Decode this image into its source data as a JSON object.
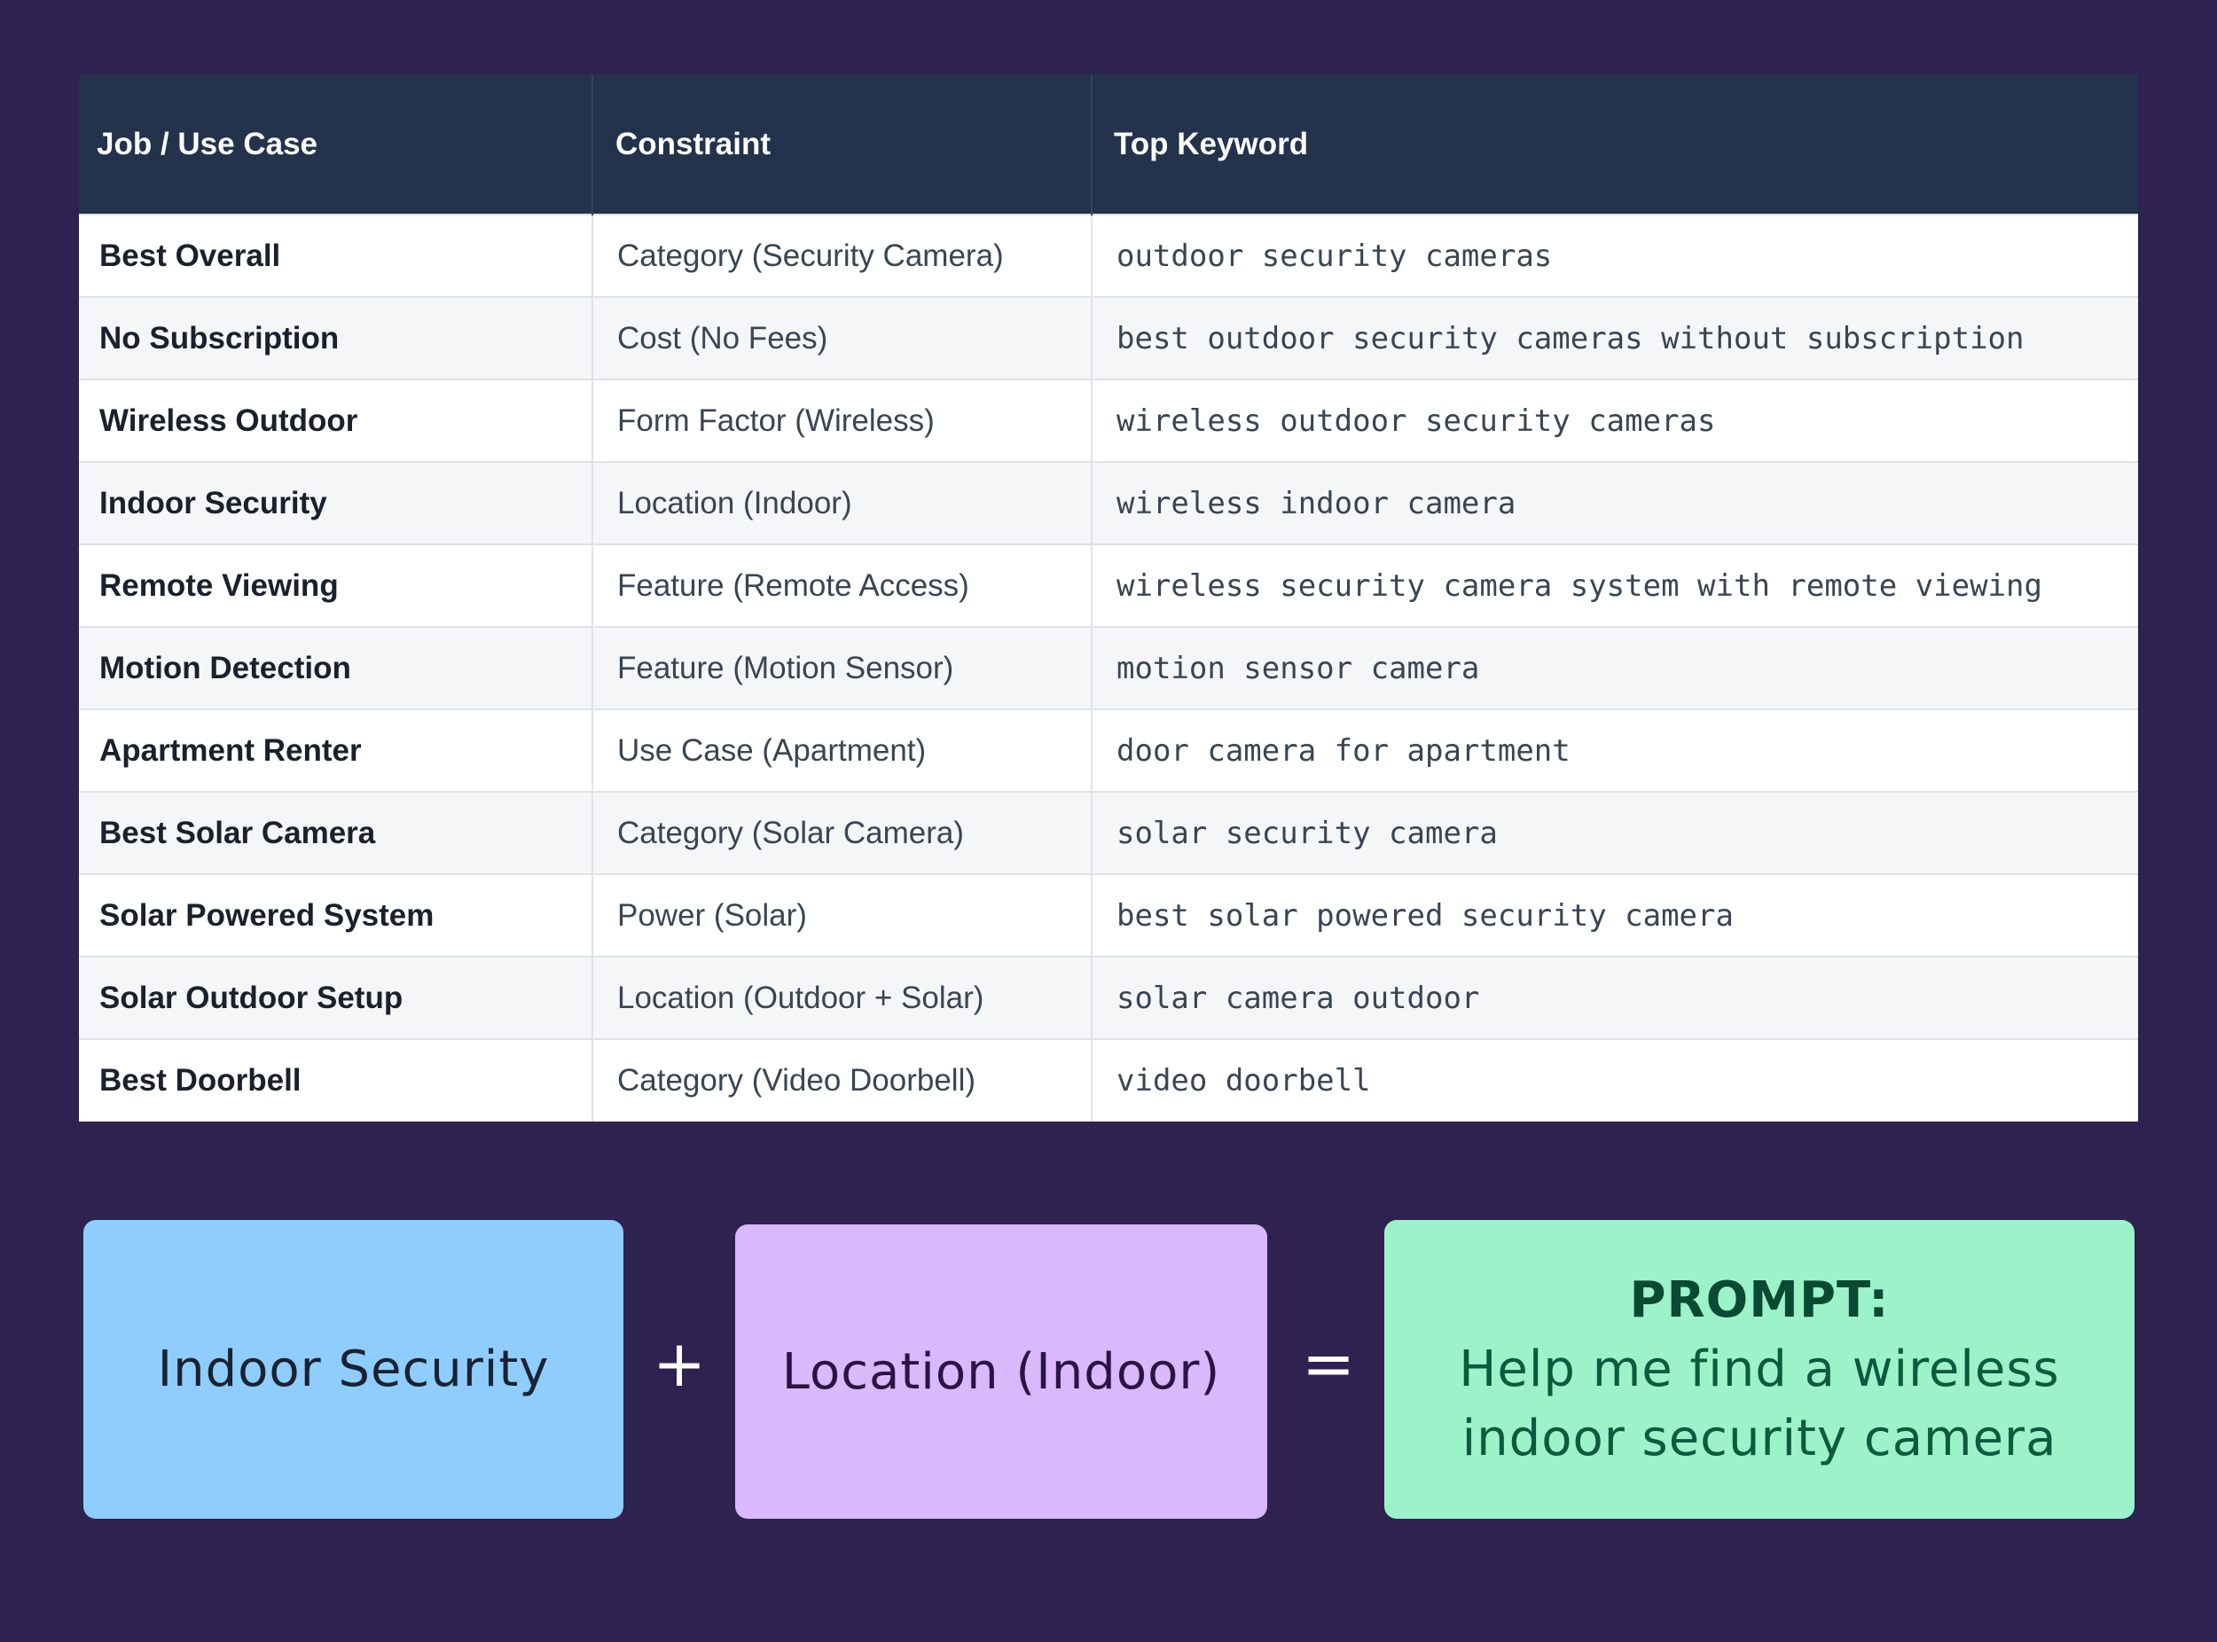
{
  "table": {
    "headers": [
      "Job / Use Case",
      "Constraint",
      "Top Keyword"
    ],
    "rows": [
      {
        "job": "Best Overall",
        "constraint": "Category (Security Camera)",
        "keyword": "outdoor security cameras"
      },
      {
        "job": "No Subscription",
        "constraint": "Cost (No Fees)",
        "keyword": "best outdoor security cameras without subscription"
      },
      {
        "job": "Wireless Outdoor",
        "constraint": "Form Factor (Wireless)",
        "keyword": "wireless outdoor security cameras"
      },
      {
        "job": "Indoor Security",
        "constraint": "Location (Indoor)",
        "keyword": "wireless indoor camera"
      },
      {
        "job": "Remote Viewing",
        "constraint": "Feature (Remote Access)",
        "keyword": "wireless security camera system with remote viewing"
      },
      {
        "job": "Motion Detection",
        "constraint": "Feature (Motion Sensor)",
        "keyword": "motion sensor camera"
      },
      {
        "job": "Apartment Renter",
        "constraint": "Use Case (Apartment)",
        "keyword": "door camera for apartment"
      },
      {
        "job": "Best Solar Camera",
        "constraint": "Category (Solar Camera)",
        "keyword": "solar security camera"
      },
      {
        "job": "Solar Powered System",
        "constraint": "Power (Solar)",
        "keyword": "best solar powered security camera"
      },
      {
        "job": "Solar Outdoor Setup",
        "constraint": "Location (Outdoor + Solar)",
        "keyword": "solar camera outdoor"
      },
      {
        "job": "Best Doorbell",
        "constraint": "Category (Video Doorbell)",
        "keyword": "video doorbell"
      }
    ]
  },
  "formula": {
    "left": "Indoor Security",
    "plus": "+",
    "middle": "Location (Indoor)",
    "equals": "=",
    "result_label": "PROMPT:",
    "result_line1": "Help me find a wireless",
    "result_line2": "indoor security camera"
  },
  "colors": {
    "background": "#2e2250",
    "header": "#22334b",
    "box_left": "#8ecdfd",
    "box_middle": "#d9b8fb",
    "box_result": "#9df3c9"
  }
}
